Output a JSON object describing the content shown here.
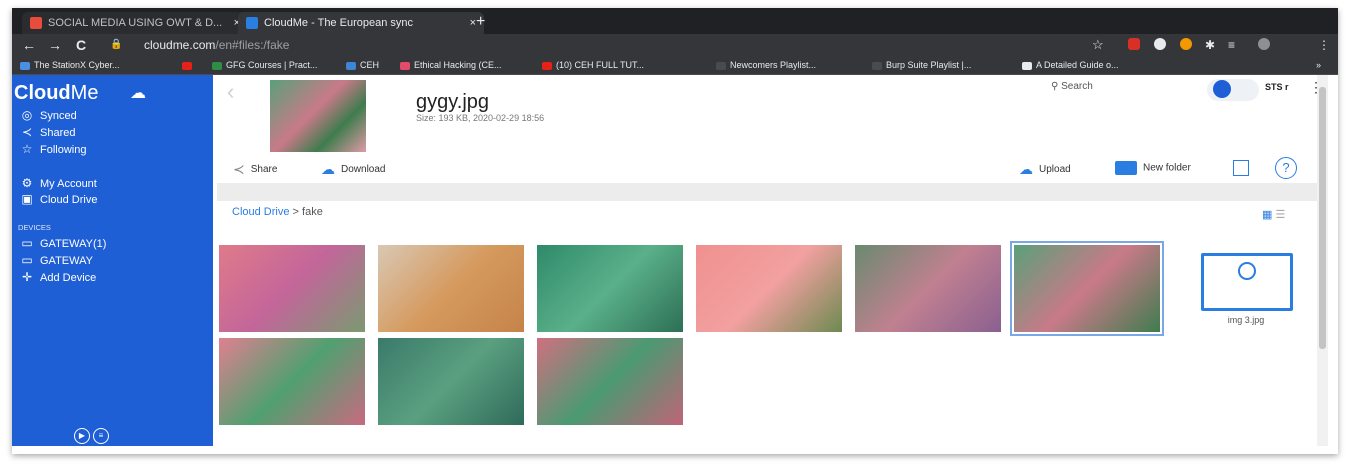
{
  "browser": {
    "tabs": [
      {
        "label": "SOCIAL MEDIA USING OWT & D...",
        "close": "×"
      },
      {
        "label": "CloudMe - The European sync",
        "close": "×"
      }
    ],
    "new_tab": "+",
    "url_host": "cloudme.com",
    "url_path": "/en#files:/fake",
    "bookmarks": [
      "The StationX Cyber...",
      "GFG Courses | Pract...",
      "CEH",
      "Ethical Hacking (CE...",
      "(10) CEH FULL TUT...",
      "Newcomers Playlist...",
      "Burp Suite Playlist |...",
      "A Detailed Guide o..."
    ],
    "bookmarks_more": "»"
  },
  "sidebar": {
    "logo_bold": "Cloud",
    "logo_light": "Me",
    "items": [
      {
        "label": "Synced",
        "icon": "sync-icon"
      },
      {
        "label": "Shared",
        "icon": "share-icon"
      },
      {
        "label": "Following",
        "icon": "star-icon"
      },
      {
        "label": "My Account",
        "icon": "gear-icon"
      },
      {
        "label": "Cloud Drive",
        "icon": "drive-icon"
      }
    ],
    "devices_label": "DEVICES",
    "devices": [
      "GATEWAY(1)",
      "GATEWAY"
    ],
    "add_device": "Add Device"
  },
  "file": {
    "name": "gygy.jpg",
    "meta": "Size: 193 KB, 2020-02-29 18:56"
  },
  "header": {
    "search": "Search",
    "user": "STS r"
  },
  "toolbar": {
    "share": "Share",
    "download": "Download",
    "upload": "Upload",
    "new_folder": "New folder",
    "help": "?"
  },
  "breadcrumb": {
    "root": "Cloud Drive",
    "sep": ">",
    "current": "fake"
  },
  "files": [
    {
      "type": "image",
      "gradient": "linear-gradient(135deg,#e07a8a,#c2669a,#7a9a70)"
    },
    {
      "type": "image",
      "gradient": "linear-gradient(135deg,#d9c8b4,#d59a5e,#c5834a)"
    },
    {
      "type": "image",
      "gradient": "linear-gradient(135deg,#2f8a6a,#5ab08a,#2d6f55)"
    },
    {
      "type": "image",
      "gradient": "linear-gradient(135deg,#f09090,#f2a0a0,#6d8a50)"
    },
    {
      "type": "image",
      "gradient": "linear-gradient(135deg,#6a8a70,#c08090,#8a6090)"
    },
    {
      "type": "image",
      "gradient": "linear-gradient(135deg,#5aa07a,#c87a88,#3f7c4e)",
      "selected": true
    },
    {
      "type": "placeholder",
      "label": "img 3.jpg"
    },
    {
      "type": "image",
      "gradient": "linear-gradient(135deg,#e08090,#50a070,#c86a80)"
    },
    {
      "type": "image",
      "gradient": "linear-gradient(135deg,#3a7a6a,#5aa080,#2f6a5a)"
    },
    {
      "type": "image",
      "gradient": "linear-gradient(135deg,#d07080,#4a9a72,#c06478)"
    }
  ]
}
